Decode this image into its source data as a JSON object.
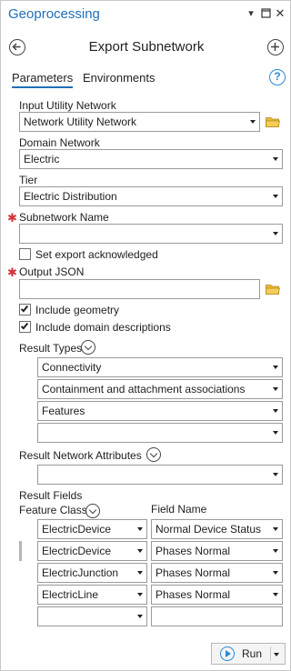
{
  "titlebar": {
    "title": "Geoprocessing"
  },
  "header": {
    "title": "Export Subnetwork"
  },
  "tabs": {
    "parameters": "Parameters",
    "environments": "Environments",
    "help": "?"
  },
  "fields": {
    "input_utility_network": {
      "label": "Input Utility Network",
      "value": "Network Utility Network"
    },
    "domain_network": {
      "label": "Domain Network",
      "value": "Electric"
    },
    "tier": {
      "label": "Tier",
      "value": "Electric Distribution"
    },
    "subnetwork_name": {
      "label": "Subnetwork Name",
      "value": ""
    },
    "set_export_acknowledged": {
      "label": "Set export acknowledged",
      "checked": false
    },
    "output_json": {
      "label": "Output JSON",
      "value": ""
    },
    "include_geometry": {
      "label": "Include geometry",
      "checked": true
    },
    "include_domain_descriptions": {
      "label": "Include domain descriptions",
      "checked": true
    }
  },
  "result_types": {
    "label": "Result Types",
    "items": [
      "Connectivity",
      "Containment and attachment associations",
      "Features",
      ""
    ]
  },
  "result_network_attributes": {
    "label": "Result Network Attributes",
    "items": [
      ""
    ]
  },
  "result_fields": {
    "label": "Result Fields",
    "feature_class_label": "Feature Class",
    "field_name_label": "Field Name",
    "rows": [
      {
        "feature_class": "ElectricDevice",
        "field_name": "Normal Device Status"
      },
      {
        "feature_class": "ElectricDevice",
        "field_name": "Phases Normal"
      },
      {
        "feature_class": "ElectricJunction",
        "field_name": "Phases Normal"
      },
      {
        "feature_class": "ElectricLine",
        "field_name": "Phases Normal"
      },
      {
        "feature_class": "",
        "field_name": ""
      }
    ]
  },
  "run": {
    "label": "Run"
  }
}
